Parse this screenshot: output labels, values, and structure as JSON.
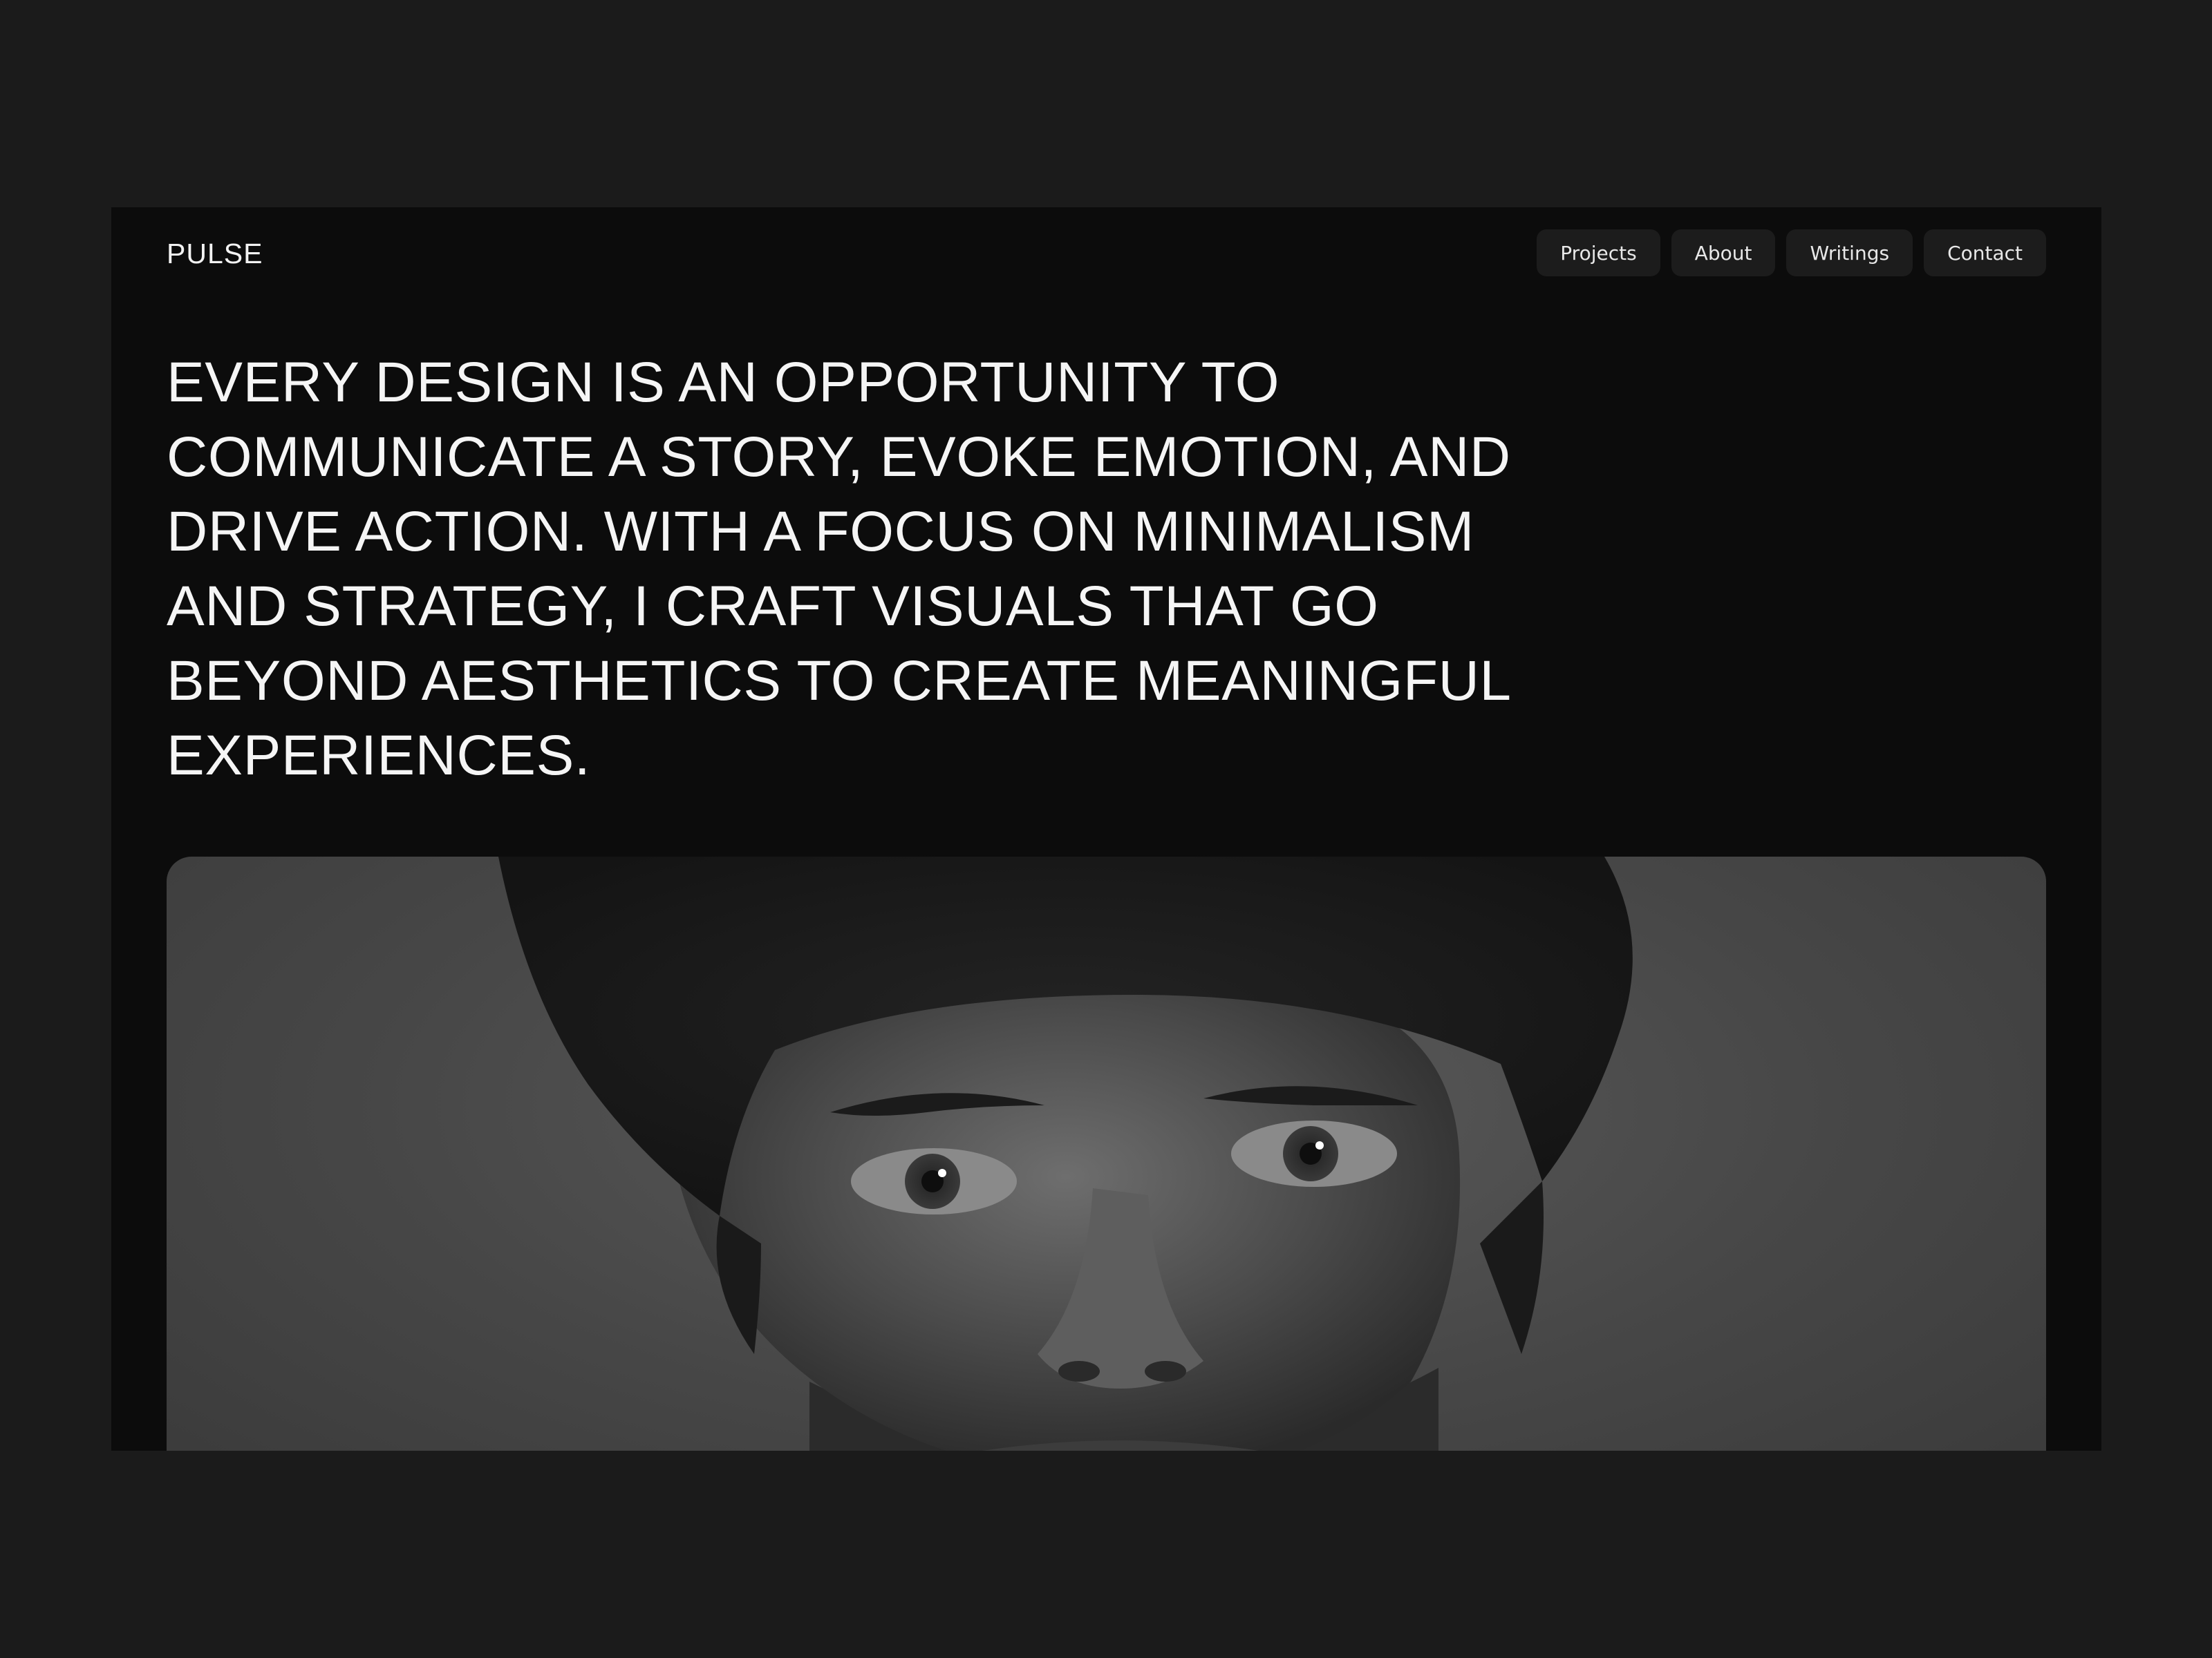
{
  "site": {
    "brand": "PULSE"
  },
  "nav": {
    "items": [
      {
        "label": "Projects"
      },
      {
        "label": "About"
      },
      {
        "label": "Writings"
      },
      {
        "label": "Contact"
      }
    ]
  },
  "hero": {
    "headline": "EVERY DESIGN IS AN OPPORTUNITY TO COMMUNICATE A STORY, EVOKE EMOTION, AND DRIVE ACTION. WITH A FOCUS ON MINIMALISM AND STRATEGY, I CRAFT VISUALS THAT GO BEYOND AESTHETICS TO CREATE MEANINGFUL EXPERIENCES."
  },
  "theme": {
    "page_background": "#1b1b1b",
    "window_background": "#0c0c0c",
    "nav_pill_background": "#1c1c1c",
    "text_color": "#f5f5f5"
  }
}
